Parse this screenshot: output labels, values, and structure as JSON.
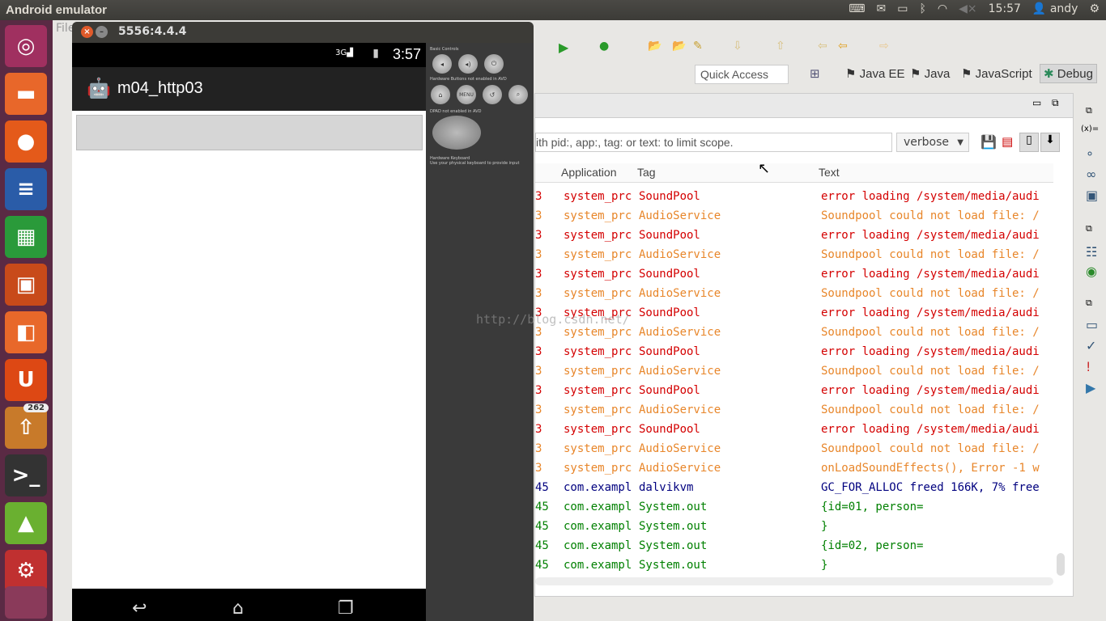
{
  "topbar": {
    "title": "Android emulator",
    "time": "15:57",
    "user": "andy"
  },
  "launcher": {
    "badge": "262"
  },
  "eclipse": {
    "menu_file": "File",
    "quick_access": "Quick Access",
    "perspectives": [
      "Java EE",
      "Java",
      "JavaScript",
      "Debug"
    ],
    "logcat": {
      "filter_placeholder": "ith pid:, app:, tag: or text: to limit scope.",
      "level": "verbose",
      "headers": [
        "Application",
        "Tag",
        "Text"
      ],
      "rows": [
        {
          "pid": "3",
          "app": "system_prc",
          "tag": "SoundPool",
          "text": "error loading /system/media/audi",
          "lvl": "E"
        },
        {
          "pid": "3",
          "app": "system_prc",
          "tag": "AudioService",
          "text": "Soundpool could not load file: /",
          "lvl": "W"
        },
        {
          "pid": "3",
          "app": "system_prc",
          "tag": "SoundPool",
          "text": "error loading /system/media/audi",
          "lvl": "E"
        },
        {
          "pid": "3",
          "app": "system_prc",
          "tag": "AudioService",
          "text": "Soundpool could not load file: /",
          "lvl": "W"
        },
        {
          "pid": "3",
          "app": "system_prc",
          "tag": "SoundPool",
          "text": "error loading /system/media/audi",
          "lvl": "E"
        },
        {
          "pid": "3",
          "app": "system_prc",
          "tag": "AudioService",
          "text": "Soundpool could not load file: /",
          "lvl": "W"
        },
        {
          "pid": "3",
          "app": "system_prc",
          "tag": "SoundPool",
          "text": "error loading /system/media/audi",
          "lvl": "E"
        },
        {
          "pid": "3",
          "app": "system_prc",
          "tag": "AudioService",
          "text": "Soundpool could not load file: /",
          "lvl": "W"
        },
        {
          "pid": "3",
          "app": "system_prc",
          "tag": "SoundPool",
          "text": "error loading /system/media/audi",
          "lvl": "E"
        },
        {
          "pid": "3",
          "app": "system_prc",
          "tag": "AudioService",
          "text": "Soundpool could not load file: /",
          "lvl": "W"
        },
        {
          "pid": "3",
          "app": "system_prc",
          "tag": "SoundPool",
          "text": "error loading /system/media/audi",
          "lvl": "E"
        },
        {
          "pid": "3",
          "app": "system_prc",
          "tag": "AudioService",
          "text": "Soundpool could not load file: /",
          "lvl": "W"
        },
        {
          "pid": "3",
          "app": "system_prc",
          "tag": "SoundPool",
          "text": "error loading /system/media/audi",
          "lvl": "E"
        },
        {
          "pid": "3",
          "app": "system_prc",
          "tag": "AudioService",
          "text": "Soundpool could not load file: /",
          "lvl": "W"
        },
        {
          "pid": "3",
          "app": "system_prc",
          "tag": "AudioService",
          "text": "onLoadSoundEffects(), Error -1 w",
          "lvl": "W"
        },
        {
          "pid": "45",
          "app": "com.exampl",
          "tag": "dalvikvm",
          "text": "GC_FOR_ALLOC freed 166K, 7% free",
          "lvl": "D"
        },
        {
          "pid": "45",
          "app": "com.exampl",
          "tag": "System.out",
          "text": "{id=01, person=",
          "lvl": "I"
        },
        {
          "pid": "45",
          "app": "com.exampl",
          "tag": "System.out",
          "text": "}",
          "lvl": "I"
        },
        {
          "pid": "45",
          "app": "com.exampl",
          "tag": "System.out",
          "text": "{id=02, person=",
          "lvl": "I"
        },
        {
          "pid": "45",
          "app": "com.exampl",
          "tag": "System.out",
          "text": "}",
          "lvl": "I"
        }
      ]
    },
    "right_sidebar": {
      "variables_label": "(x)="
    }
  },
  "colors": {
    "E": "#d40000",
    "W": "#e8862a",
    "D": "#00007f",
    "I": "#008000"
  },
  "emulator": {
    "title": "5556:4.4.4",
    "status_time": "3:57",
    "network": "3G",
    "app_title": "m04_http03",
    "controls": {
      "basic": "Basic Controls",
      "hw": "Hardware Buttons not enabled in AVD",
      "dpad": "DPAD not enabled in AVD",
      "kbd": "Hardware Keyboard",
      "kbd_hint": "Use your physical keyboard to provide input",
      "menu": "MENU"
    }
  },
  "watermark": "http://blog.csdn.net/"
}
